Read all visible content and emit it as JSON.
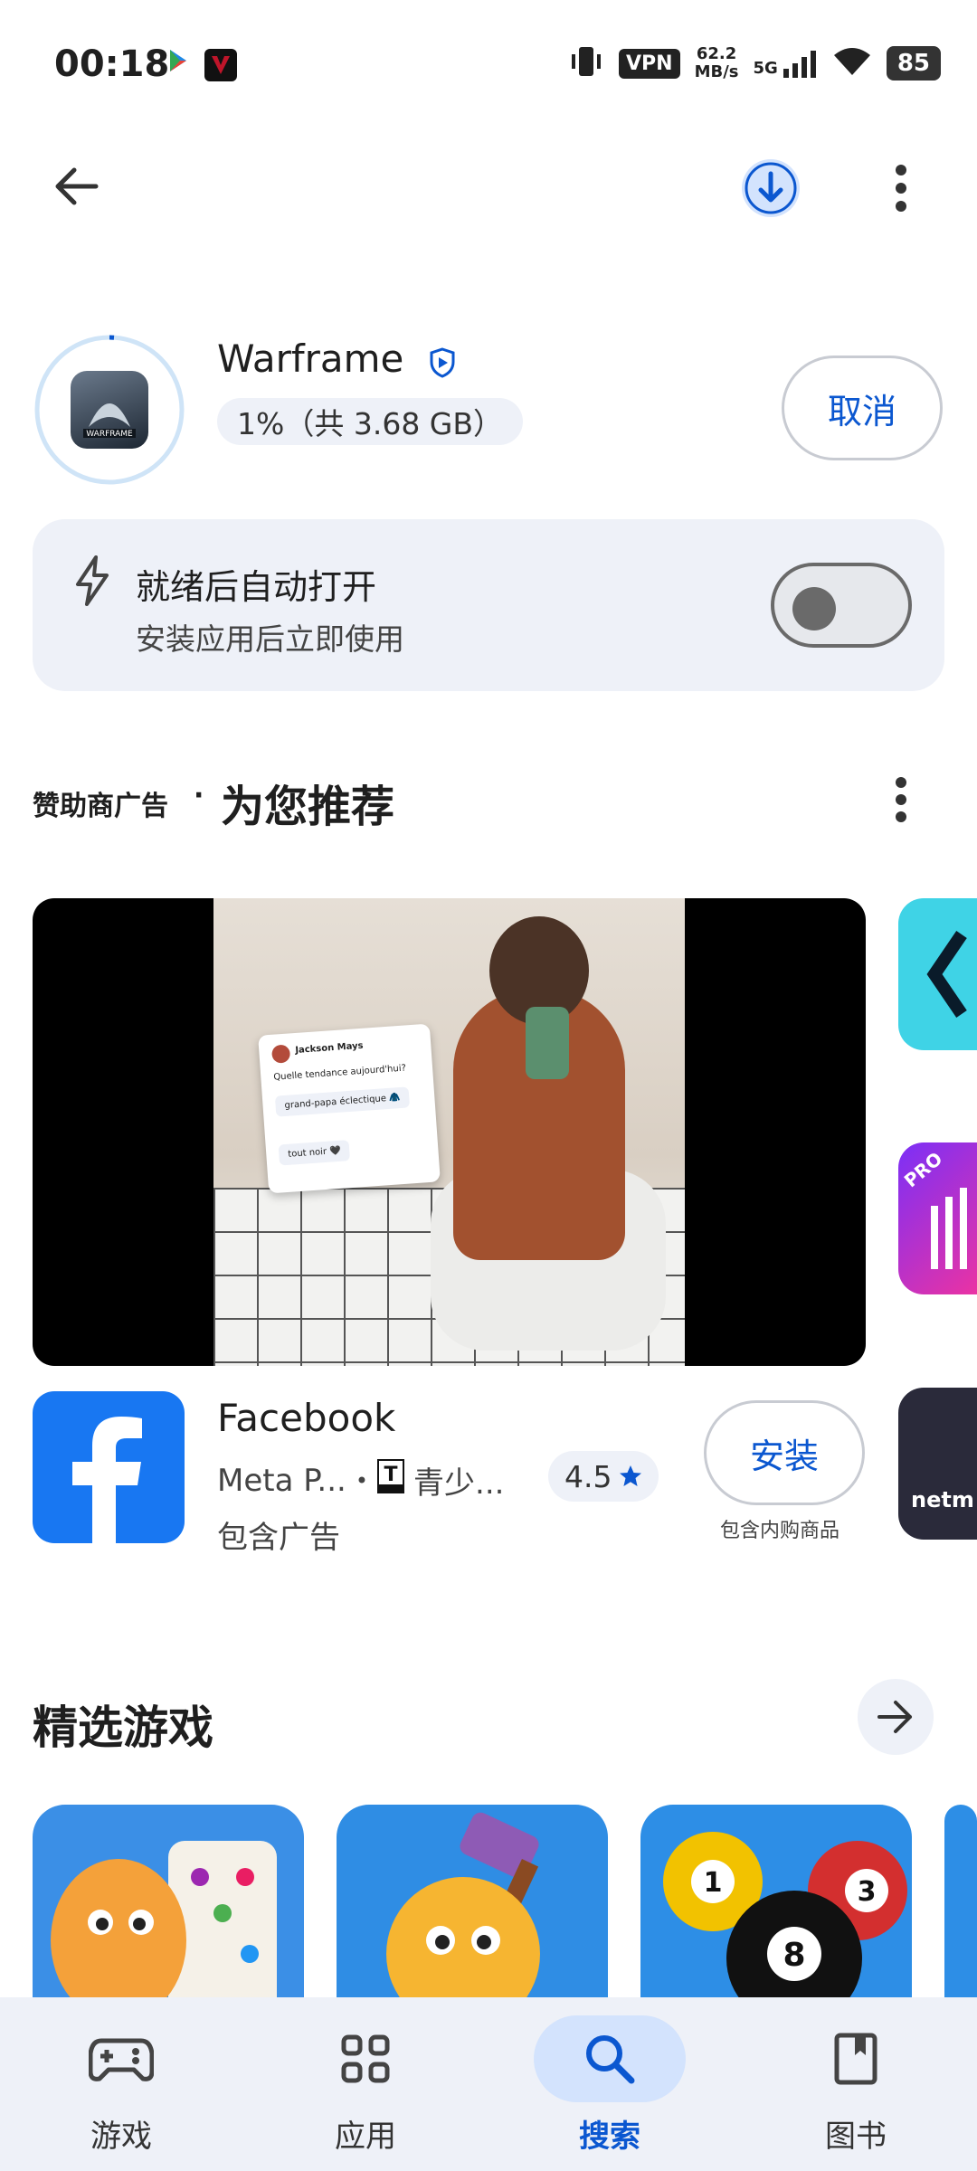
{
  "status_bar": {
    "time": "00:18",
    "vpn": "VPN",
    "speed_value": "62.2",
    "speed_unit": "MB/s",
    "network": "5G",
    "battery": "85"
  },
  "app": {
    "name": "Warframe",
    "download_progress": 0.01,
    "progress_text": "1%（共 3.68 GB）",
    "cancel_label": "取消"
  },
  "auto_open": {
    "title": "就绪后自动打开",
    "subtitle": "安装应用后立即使用",
    "enabled": false
  },
  "recommend_section": {
    "ad_label": "赞助商广告",
    "separator": "·",
    "title": "为您推荐"
  },
  "video_card": {
    "chat_name": "Jackson Mays",
    "chat_question": "Quelle tendance aujourd'hui?",
    "option1": "grand-papa éclectique 🧥",
    "option2": "tout noir 🖤"
  },
  "facebook": {
    "name": "Facebook",
    "developer": "Meta P...",
    "bullet": "•",
    "content_rating": "青少...",
    "rating": "4.5",
    "ads_label": "包含广告",
    "install_label": "安装",
    "iap_label": "包含内购商品"
  },
  "peeks": {
    "pro_badge": "PRO",
    "netmarble_text": "netm"
  },
  "games_section": {
    "title": "精选游戏"
  },
  "bottom_nav": [
    {
      "label": "游戏",
      "icon": "gamepad-icon",
      "active": false
    },
    {
      "label": "应用",
      "icon": "apps-grid-icon",
      "active": false
    },
    {
      "label": "搜索",
      "icon": "search-icon",
      "active": true
    },
    {
      "label": "图书",
      "icon": "book-icon",
      "active": false
    }
  ],
  "colors": {
    "accent": "#0b57d0",
    "surface": "#eef1f8",
    "facebook_blue": "#1877f2"
  }
}
